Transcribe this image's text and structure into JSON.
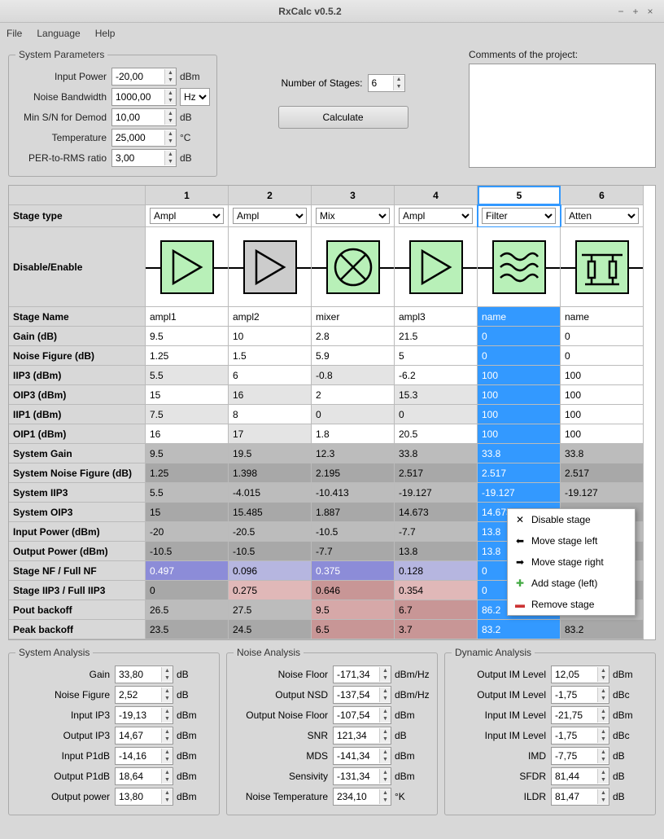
{
  "window": {
    "title": "RxCalc v0.5.2"
  },
  "menu": {
    "file": "File",
    "language": "Language",
    "help": "Help"
  },
  "sysparams": {
    "legend": "System Parameters",
    "input_power_lbl": "Input Power",
    "input_power": "-20,00",
    "input_power_unit": "dBm",
    "noise_bw_lbl": "Noise Bandwidth",
    "noise_bw": "1000,00",
    "noise_bw_unit": "Hz",
    "min_sn_lbl": "Min S/N for Demod",
    "min_sn": "10,00",
    "min_sn_unit": "dB",
    "temp_lbl": "Temperature",
    "temp": "25,000",
    "temp_unit": "°C",
    "per_lbl": "PER-to-RMS ratio",
    "per": "3,00",
    "per_unit": "dB"
  },
  "midcol": {
    "numstages_lbl": "Number of Stages:",
    "numstages": "6",
    "calculate": "Calculate"
  },
  "comments": {
    "label": "Comments of the project:",
    "value": ""
  },
  "table": {
    "col_headers": [
      "1",
      "2",
      "3",
      "4",
      "5",
      "6"
    ],
    "stage_type_lbl": "Stage type",
    "stage_types": [
      "Ampl",
      "Ampl",
      "Mix",
      "Ampl",
      "Filter",
      "Atten"
    ],
    "disable_enable_lbl": "Disable/Enable",
    "rows": {
      "stage_name": {
        "lbl": "Stage Name",
        "v": [
          "ampl1",
          "ampl2",
          "mixer",
          "ampl3",
          "name",
          "name"
        ]
      },
      "gain": {
        "lbl": "Gain (dB)",
        "v": [
          "9.5",
          "10",
          "2.8",
          "21.5",
          "0",
          "0"
        ]
      },
      "nf": {
        "lbl": "Noise Figure (dB)",
        "v": [
          "1.25",
          "1.5",
          "5.9",
          "5",
          "0",
          "0"
        ]
      },
      "iip3": {
        "lbl": "IIP3 (dBm)",
        "v": [
          "5.5",
          "6",
          "-0.8",
          "-6.2",
          "100",
          "100"
        ]
      },
      "oip3": {
        "lbl": "OIP3 (dBm)",
        "v": [
          "15",
          "16",
          "2",
          "15.3",
          "100",
          "100"
        ]
      },
      "iip1": {
        "lbl": "IIP1 (dBm)",
        "v": [
          "7.5",
          "8",
          "0",
          "0",
          "100",
          "100"
        ]
      },
      "oip1": {
        "lbl": "OIP1 (dBm)",
        "v": [
          "16",
          "17",
          "1.8",
          "20.5",
          "100",
          "100"
        ]
      },
      "sysgain": {
        "lbl": "System Gain",
        "v": [
          "9.5",
          "19.5",
          "12.3",
          "33.8",
          "33.8",
          "33.8"
        ]
      },
      "sysnf": {
        "lbl": "System Noise Figure (dB)",
        "v": [
          "1.25",
          "1.398",
          "2.195",
          "2.517",
          "2.517",
          "2.517"
        ]
      },
      "sysiip3": {
        "lbl": "System IIP3",
        "v": [
          "5.5",
          "-4.015",
          "-10.413",
          "-19.127",
          "-19.127",
          "-19.127"
        ]
      },
      "sysoip3": {
        "lbl": "System OIP3",
        "v": [
          "15",
          "15.485",
          "1.887",
          "14.673",
          "14.673",
          ""
        ]
      },
      "inpower": {
        "lbl": "Input Power (dBm)",
        "v": [
          "-20",
          "-20.5",
          "-10.5",
          "-7.7",
          "13.8",
          ""
        ]
      },
      "outpower": {
        "lbl": "Output Power (dBm)",
        "v": [
          "-10.5",
          "-10.5",
          "-7.7",
          "13.8",
          "13.8",
          ""
        ]
      },
      "stagenf": {
        "lbl": "Stage NF / Full NF",
        "v": [
          "0.497",
          "0.096",
          "0.375",
          "0.128",
          "0",
          ""
        ]
      },
      "stageiip3": {
        "lbl": "Stage IIP3 / Full IIP3",
        "v": [
          "0",
          "0.275",
          "0.646",
          "0.354",
          "0",
          ""
        ]
      },
      "poutback": {
        "lbl": "Pout backoff",
        "v": [
          "26.5",
          "27.5",
          "9.5",
          "6.7",
          "86.2",
          ""
        ]
      },
      "peakback": {
        "lbl": "Peak backoff",
        "v": [
          "23.5",
          "24.5",
          "6.5",
          "3.7",
          "83.2",
          "83.2"
        ]
      }
    }
  },
  "ctxmenu": {
    "disable": "Disable stage",
    "left": "Move stage left",
    "right": "Move stage right",
    "add": "Add stage (left)",
    "remove": "Remove stage"
  },
  "sysanalysis": {
    "legend": "System Analysis",
    "gain_lbl": "Gain",
    "gain": "33,80",
    "gain_u": "dB",
    "nf_lbl": "Noise Figure",
    "nf": "2,52",
    "nf_u": "dB",
    "iip3_lbl": "Input IP3",
    "iip3": "-19,13",
    "iip3_u": "dBm",
    "oip3_lbl": "Output IP3",
    "oip3": "14,67",
    "oip3_u": "dBm",
    "ip1_lbl": "Input P1dB",
    "ip1": "-14,16",
    "ip1_u": "dBm",
    "op1_lbl": "Output P1dB",
    "op1": "18,64",
    "op1_u": "dBm",
    "outp_lbl": "Output power",
    "outp": "13,80",
    "outp_u": "dBm"
  },
  "noiseanalysis": {
    "legend": "Noise Analysis",
    "nfloor_lbl": "Noise Floor",
    "nfloor": "-171,34",
    "nfloor_u": "dBm/Hz",
    "onsd_lbl": "Output NSD",
    "onsd": "-137,54",
    "onsd_u": "dBm/Hz",
    "onf_lbl": "Output Noise Floor",
    "onf": "-107,54",
    "onf_u": "dBm",
    "snr_lbl": "SNR",
    "snr": "121,34",
    "snr_u": "dB",
    "mds_lbl": "MDS",
    "mds": "-141,34",
    "mds_u": "dBm",
    "sens_lbl": "Sensivity",
    "sens": "-131,34",
    "sens_u": "dBm",
    "ntemp_lbl": "Noise Temperature",
    "ntemp": "234,10",
    "ntemp_u": "°K"
  },
  "dynanalysis": {
    "legend": "Dynamic Analysis",
    "oim1_lbl": "Output IM Level",
    "oim1": "12,05",
    "oim1_u": "dBm",
    "oim2_lbl": "Output IM Level",
    "oim2": "-1,75",
    "oim2_u": "dBc",
    "iim1_lbl": "Input IM Level",
    "iim1": "-21,75",
    "iim1_u": "dBm",
    "iim2_lbl": "Input IM Level",
    "iim2": "-1,75",
    "iim2_u": "dBc",
    "imd_lbl": "IMD",
    "imd": "-7,75",
    "imd_u": "dB",
    "sfdr_lbl": "SFDR",
    "sfdr": "81,44",
    "sfdr_u": "dB",
    "ildr_lbl": "ILDR",
    "ildr": "81,47",
    "ildr_u": "dB"
  }
}
